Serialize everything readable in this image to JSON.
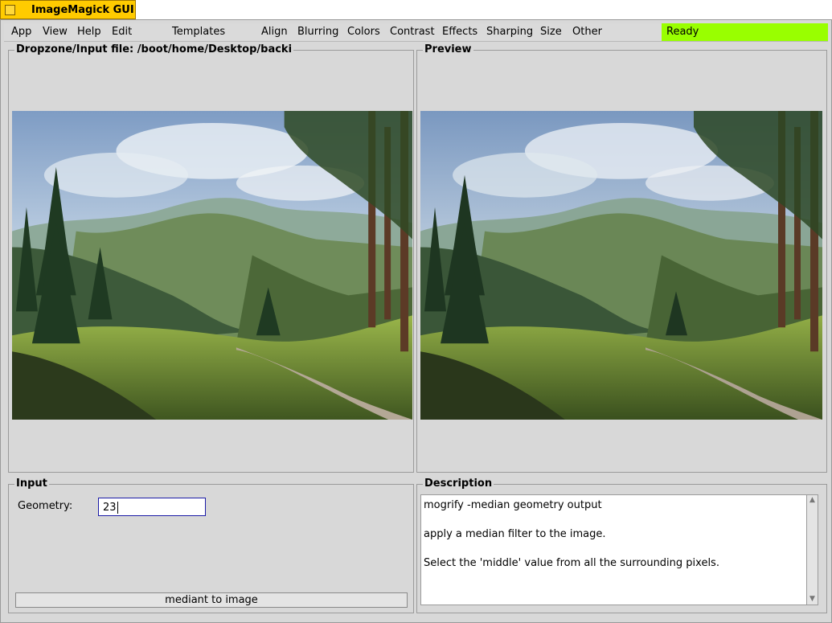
{
  "window": {
    "title": "ImageMagick GUI"
  },
  "menubar": {
    "items": [
      "App",
      "View",
      "Help",
      "Edit",
      "Templates",
      "Align",
      "Blurring",
      "Colors",
      "Contrast",
      "Effects",
      "Sharping",
      "Size",
      "Other"
    ],
    "status": "Ready",
    "status_color": "#99ff00"
  },
  "input_panel": {
    "label": "Dropzone/Input file: /boot/home/Desktop/backi"
  },
  "preview_panel": {
    "label": "Preview"
  },
  "input_box": {
    "label": "Input",
    "geometry_label": "Geometry:",
    "geometry_value": "23",
    "button_label": "mediant to image"
  },
  "description": {
    "label": "Description",
    "lines": [
      "mogrify -median geometry output",
      "apply a median filter to the image.",
      "Select the 'middle' value from all the surrounding pixels."
    ]
  }
}
